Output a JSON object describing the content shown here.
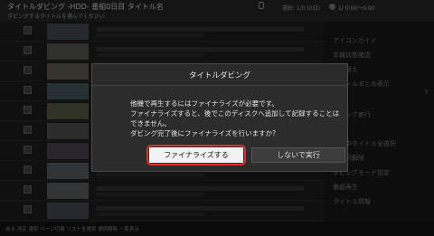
{
  "header": {
    "title": "タイトルダビング ‐HDD‐ 番組0日目 タイトル名",
    "subtitle": "ダビングするタイトルを選んでください",
    "count": "選択: 1/0 (0日)",
    "time": "1/ 0:00～0:00"
  },
  "side_menu": {
    "items": [
      "アイコンガイド",
      "本機状態確認",
      "並び替え",
      "タイトルまとめ表示",
      "ダビング実行",
      "消去",
      "番組中タイトル全選択",
      "全選択解除",
      "ダビングモード設定",
      "番組再生",
      "タイトル情報"
    ]
  },
  "footer": {
    "text": "戻る  決定  選択  ページ切換  リスト全選択  選択解除  一覧表示"
  },
  "dialog": {
    "title": "タイトルダビング",
    "message_lines": [
      "他機で再生するにはファイナライズが必要です。",
      "ファイナライズすると、後でこのディスクへ追加して記録することは",
      "できません。",
      "ダビング完了後にファイナライズを行いますか？"
    ],
    "primary_button": "ファイナライズする",
    "secondary_button": "しないで実行"
  },
  "colors": {
    "focus_ring": "#e0302a",
    "primary_button_bg": "#f2f2f2",
    "dialog_bg": "#2c2c2c"
  }
}
